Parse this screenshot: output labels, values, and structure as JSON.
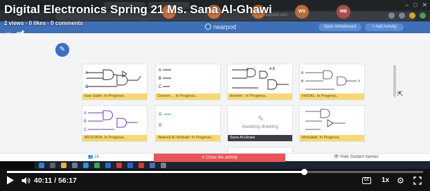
{
  "video": {
    "title": "Digital Electronics Spring 21 Ms. Sana Al-Ghawi",
    "stats": "2 views · 0 likes · 0 comments",
    "time_text": "40:11 / 56:17",
    "progress": 0.714,
    "speed": "1x",
    "cc_label": "CC"
  },
  "nearpod": {
    "logo_text": "nearpod",
    "header_buttons": [
      "Open Whiteboard",
      "+ Add Activity"
    ]
  },
  "cards": [
    {
      "label": "Issa Salim: In Progress..",
      "state": "drawing"
    },
    {
      "label": "Dareen ... In Progress..",
      "state": "drawing"
    },
    {
      "label": "Ibrahim : In Progress..",
      "state": "drawing"
    },
    {
      "label": "FAISAL: In Progress..",
      "state": "drawing"
    },
    {
      "label": "MUSTAFA: In Progress..",
      "state": "drawing"
    },
    {
      "label": "Waleed Al-Shekaili: In Progress..",
      "state": "drawing"
    },
    {
      "label": "Sana Al-Ghawi",
      "state": "awaiting",
      "placeholder": "Awaiting drawing"
    },
    {
      "label": "Mohallab: In Progress..",
      "state": "drawing"
    }
  ],
  "bottom_bar": {
    "students_count": "16",
    "close_activity": "Close the activity",
    "hide_names": "Hide Student Names"
  },
  "participants": [
    {
      "initials": "AS",
      "color": "#c96a3c"
    },
    {
      "initials": "DB",
      "color": "#c9703f"
    },
    {
      "initials": "FM",
      "color": "#c0703a"
    },
    {
      "initials": "WS",
      "color": "#b86a3a"
    },
    {
      "initials": "MB",
      "color": "#a64d4d"
    }
  ],
  "colors": {
    "nearpod_blue": "#3f6fb6",
    "card_label": "#f7d873",
    "close_red": "#e8555a",
    "student_green": "#3a7d5b"
  }
}
